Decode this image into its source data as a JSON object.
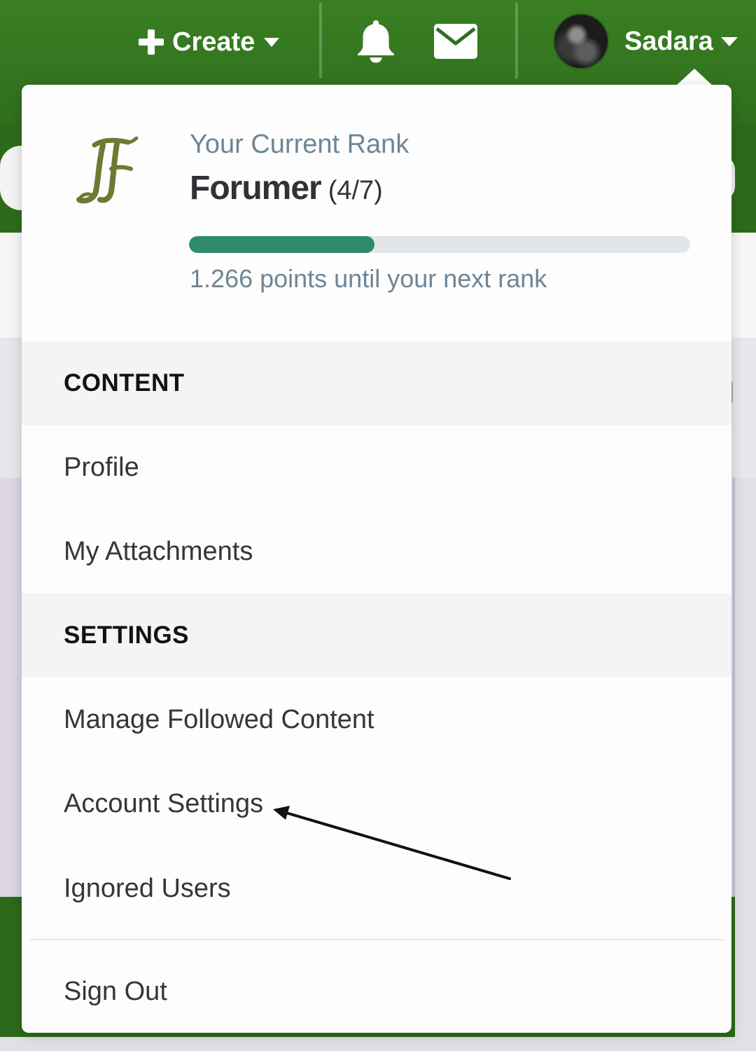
{
  "topbar": {
    "create_label": "Create",
    "user_name": "Sadara"
  },
  "rank": {
    "label": "Your Current Rank",
    "name": "Forumer",
    "level": "(4/7)",
    "progress_fraction": 0.37,
    "next_rank_note": "1.266 points until your next rank"
  },
  "menu": {
    "content_header": "CONTENT",
    "profile": "Profile",
    "my_attachments": "My Attachments",
    "settings_header": "SETTINGS",
    "manage_followed": "Manage Followed Content",
    "account_settings": "Account Settings",
    "ignored_users": "Ignored Users",
    "sign_out": "Sign Out"
  },
  "colors": {
    "brand_green": "#2f6f1d",
    "progress_fill": "#2e8c6a",
    "rank_logo": "#6e7a32"
  }
}
